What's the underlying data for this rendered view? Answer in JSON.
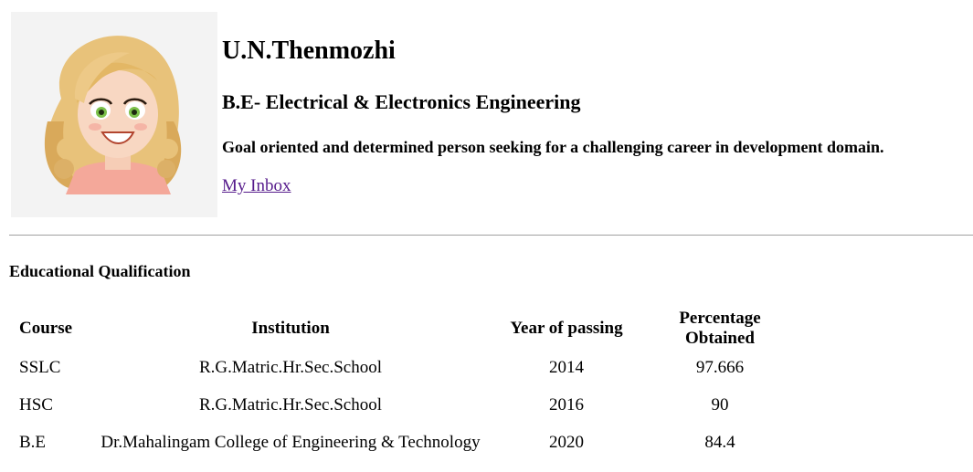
{
  "profile": {
    "name": "U.N.Thenmozhi",
    "degree": "B.E- Electrical & Electronics Engineering",
    "goal": "Goal oriented and determined person seeking for a challenging career in development domain.",
    "inbox_link": "My Inbox"
  },
  "education": {
    "title": "Educational Qualification",
    "headers": [
      "Course",
      "Institution",
      "Year of passing",
      "Percentage Obtained"
    ],
    "rows": [
      [
        "SSLC",
        "R.G.Matric.Hr.Sec.School",
        "2014",
        "97.666"
      ],
      [
        "HSC",
        "R.G.Matric.Hr.Sec.School",
        "2016",
        "90"
      ],
      [
        "B.E",
        "Dr.Mahalingam College of Engineering & Technology",
        "2020",
        "84.4"
      ]
    ]
  }
}
